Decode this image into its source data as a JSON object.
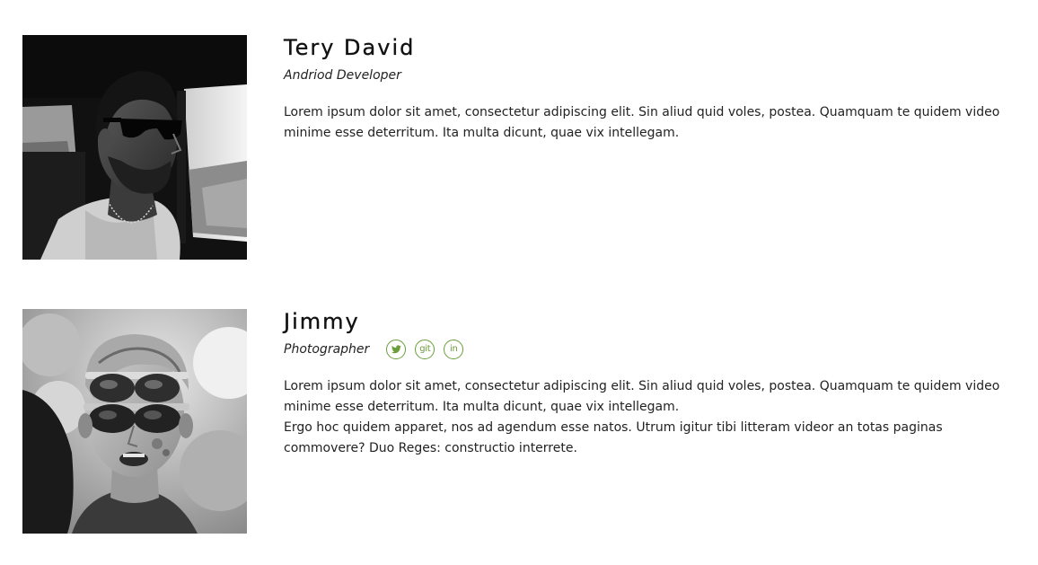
{
  "team": [
    {
      "name": "Tery David",
      "role": "Andriod Developer",
      "photo_icon": "person-portrait-sunglasses-car",
      "bio": [
        "Lorem ipsum dolor sit amet, consectetur adipiscing elit. Sin aliud quid voles, postea. Quamquam te quidem video minime esse deterritum. Ita multa dicunt, quae vix intellegam."
      ],
      "socials": []
    },
    {
      "name": "Jimmy",
      "role": "Photographer",
      "photo_icon": "person-portrait-double-sunglasses",
      "bio": [
        "Lorem ipsum dolor sit amet, consectetur adipiscing elit. Sin aliud quid voles, postea. Quamquam te quidem video minime esse deterritum. Ita multa dicunt, quae vix intellegam.",
        "Ergo hoc quidem apparet, nos ad agendum esse natos. Utrum igitur tibi litteram videor an totas paginas commovere? Duo Reges: constructio interrete."
      ],
      "socials": [
        {
          "icon": "twitter-icon",
          "label": ""
        },
        {
          "icon": "git-icon",
          "label": "git"
        },
        {
          "icon": "linkedin-icon",
          "label": "in"
        }
      ]
    }
  ],
  "colors": {
    "accent": "#6a9c3a",
    "text": "#222222",
    "heading": "#111111",
    "background": "#ffffff"
  }
}
